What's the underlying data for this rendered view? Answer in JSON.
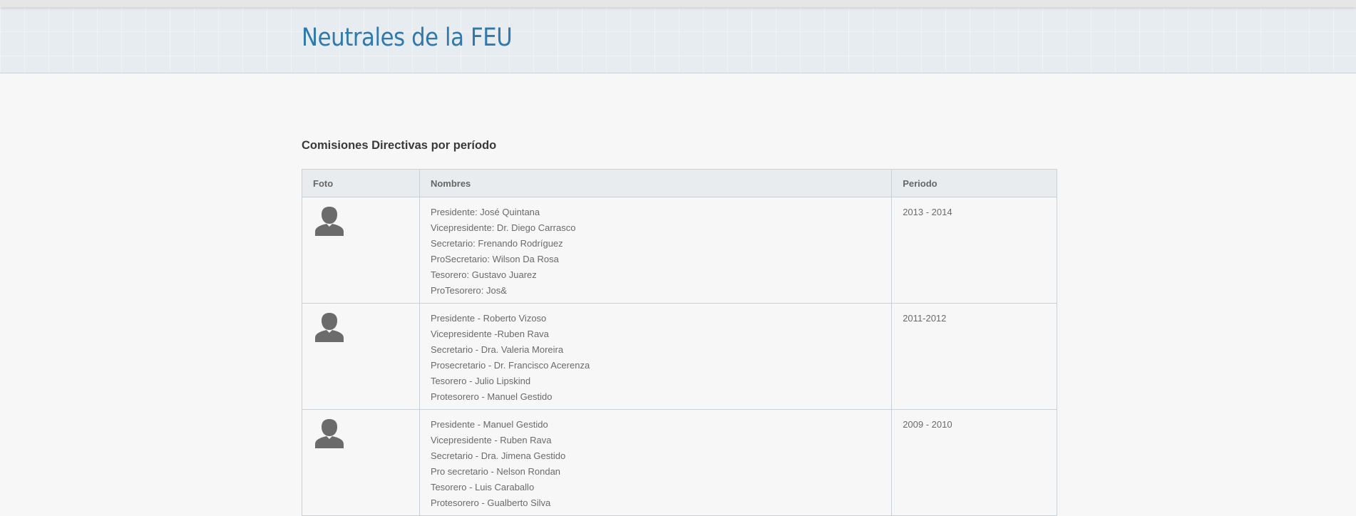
{
  "page": {
    "title": "Neutrales de la FEU"
  },
  "section": {
    "heading": "Comisiones Directivas por período"
  },
  "table": {
    "headers": {
      "foto": "Foto",
      "nombres": "Nombres",
      "periodo": "Periodo"
    },
    "rows": [
      {
        "photo_icon": "user-silhouette-icon",
        "names": [
          "Presidente: José Quintana",
          "Vicepresidente: Dr. Diego Carrasco",
          "Secretario: Frenando Rodríguez",
          "ProSecretario: Wilson Da Rosa",
          "Tesorero: Gustavo Juarez",
          "ProTesorero: Jos&"
        ],
        "period": "2013 - 2014"
      },
      {
        "photo_icon": "user-silhouette-icon",
        "names": [
          "Presidente - Roberto Vizoso",
          "Vicepresidente -Ruben Rava",
          "Secretario - Dra. Valeria Moreira",
          "Prosecretario - Dr. Francisco Acerenza",
          "Tesorero - Julio Lipskind",
          "Protesorero - Manuel Gestido"
        ],
        "period": "2011-2012"
      },
      {
        "photo_icon": "user-silhouette-icon",
        "names": [
          "Presidente - Manuel Gestido",
          "Vicepresidente - Ruben Rava",
          "Secretario - Dra. Jimena Gestido",
          "Pro secretario - Nelson Rondan",
          "Tesorero - Luis Caraballo",
          "Protesorero - Gualberto Silva"
        ],
        "period": "2009 - 2010"
      }
    ]
  },
  "colors": {
    "title": "#2f79ad",
    "header_bg": "#e7ecf1",
    "page_bg": "#f7f7f7",
    "table_header_bg": "#e9ecef",
    "border": "#c9d0d6",
    "avatar": "#6b6b6b"
  }
}
